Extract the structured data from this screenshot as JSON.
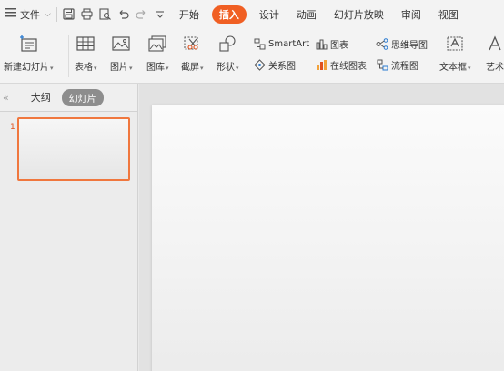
{
  "menu": {
    "file_label": "文件",
    "tabs": [
      {
        "label": "开始",
        "active": false
      },
      {
        "label": "插入",
        "active": true
      },
      {
        "label": "设计",
        "active": false
      },
      {
        "label": "动画",
        "active": false
      },
      {
        "label": "幻灯片放映",
        "active": false
      },
      {
        "label": "审阅",
        "active": false
      },
      {
        "label": "视图",
        "active": false
      }
    ]
  },
  "ribbon": {
    "new_slide": "新建幻灯片",
    "table": "表格",
    "picture": "图片",
    "gallery": "图库",
    "screenshot": "截屏",
    "shape": "形状",
    "smartart": "SmartArt",
    "relation": "关系图",
    "chart": "图表",
    "online_chart": "在线图表",
    "mindmap": "思维导图",
    "flowchart": "流程图",
    "textbox": "文本框",
    "art": "艺术"
  },
  "panel": {
    "outline_tab": "大纲",
    "slides_tab": "幻灯片",
    "slide_number": "1"
  },
  "colors": {
    "accent": "#f05f23",
    "thumb_border": "#f0773e"
  }
}
